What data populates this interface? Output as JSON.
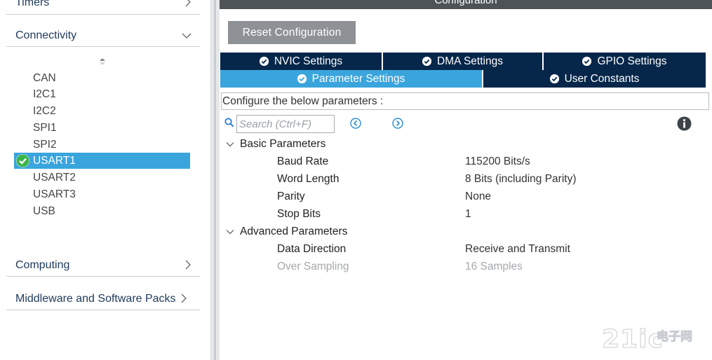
{
  "sidebar": {
    "categories": [
      {
        "label": "Timers",
        "chevron": "expand"
      },
      {
        "label": "Connectivity",
        "chevron": "collapse"
      },
      {
        "label": "Computing",
        "chevron": "expand"
      },
      {
        "label": "Middleware and Software Packs",
        "chevron": "expand"
      }
    ],
    "peripherals": [
      {
        "label": "CAN",
        "selected": false
      },
      {
        "label": "I2C1",
        "selected": false
      },
      {
        "label": "I2C2",
        "selected": false
      },
      {
        "label": "SPI1",
        "selected": false
      },
      {
        "label": "SPI2",
        "selected": false
      },
      {
        "label": "USART1",
        "selected": true,
        "status": "configured"
      },
      {
        "label": "USART2",
        "selected": false
      },
      {
        "label": "USART3",
        "selected": false
      },
      {
        "label": "USB",
        "selected": false
      }
    ]
  },
  "config": {
    "header": "Configuration",
    "reset_label": "Reset Configuration",
    "tabs_row1": [
      "NVIC Settings",
      "DMA Settings",
      "GPIO Settings"
    ],
    "tabs_row2": [
      "Parameter Settings",
      "User Constants"
    ],
    "active_tab": "Parameter Settings",
    "description": "Configure the below parameters :",
    "search_placeholder": "Search (Ctrl+F)",
    "groups": [
      {
        "label": "Basic Parameters",
        "params": [
          {
            "name": "Baud Rate",
            "value": "115200 Bits/s",
            "enabled": true
          },
          {
            "name": "Word Length",
            "value": "8 Bits (including Parity)",
            "enabled": true
          },
          {
            "name": "Parity",
            "value": "None",
            "enabled": true
          },
          {
            "name": "Stop Bits",
            "value": "1",
            "enabled": true
          }
        ]
      },
      {
        "label": "Advanced Parameters",
        "params": [
          {
            "name": "Data Direction",
            "value": "Receive and Transmit",
            "enabled": true
          },
          {
            "name": "Over Sampling",
            "value": "16 Samples",
            "enabled": false
          }
        ]
      }
    ]
  },
  "watermark": {
    "latin": "21ic",
    "chinese": "电子网"
  },
  "colors": {
    "accent": "#3aa5dc",
    "tab_dark": "#06264a",
    "button": "#8e9296",
    "check_green": "#3bb54a"
  }
}
